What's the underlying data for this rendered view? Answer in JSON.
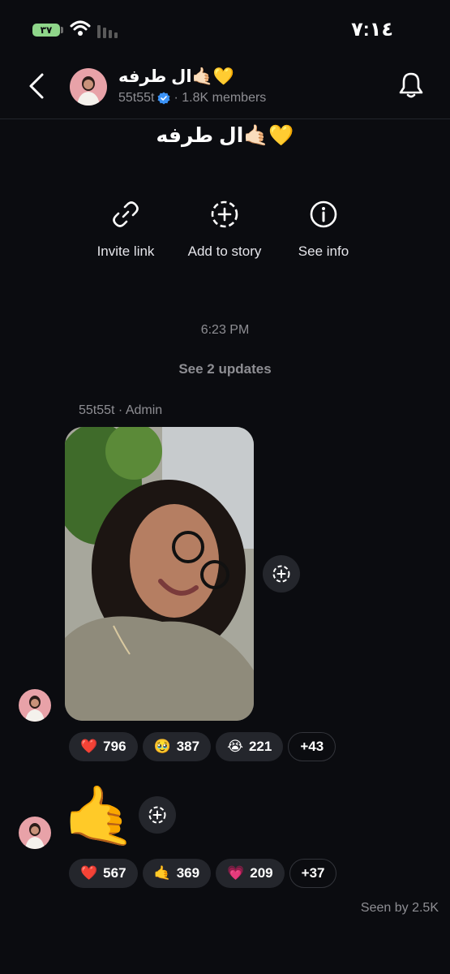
{
  "status": {
    "battery": "٣٧",
    "time": "٧:١٤"
  },
  "header": {
    "channel_name": "ال طرفه🤙🏻💛",
    "username": "55t55t",
    "members": "· 1.8K members"
  },
  "title": "ال طرفه🤙🏻💛",
  "actions": [
    {
      "label": "Invite link",
      "icon": "link-icon"
    },
    {
      "label": "Add to story",
      "icon": "add-to-story-icon"
    },
    {
      "label": "See info",
      "icon": "info-icon"
    }
  ],
  "feed": {
    "timestamp": "6:23 PM",
    "updates_label": "See 2 updates",
    "sender": "55t55t · Admin",
    "post1_reactions": [
      {
        "emoji": "❤️",
        "count": "796"
      },
      {
        "emoji": "🥹",
        "count": "387"
      },
      {
        "emoji": "😭",
        "count": "221"
      }
    ],
    "post1_more": "+43",
    "post2_emoji": "🤙",
    "post2_reactions": [
      {
        "emoji": "❤️",
        "count": "567"
      },
      {
        "emoji": "🤙",
        "count": "369"
      },
      {
        "emoji": "💗",
        "count": "209"
      }
    ],
    "post2_more": "+37",
    "seen_by": "Seen by 2.5K"
  },
  "colors": {
    "background": "#0b0c10",
    "pill": "#24262c",
    "muted": "#8e8e93",
    "verified": "#3b93f7"
  }
}
